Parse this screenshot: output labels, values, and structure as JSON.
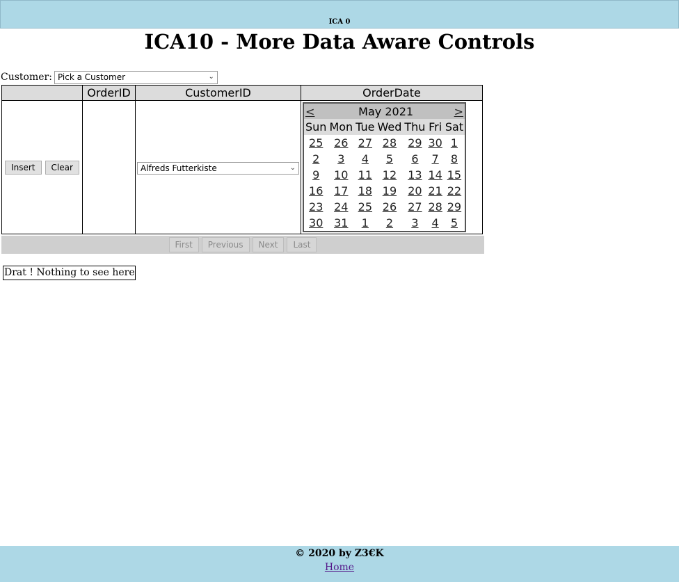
{
  "header": {
    "tag": "ICA 0",
    "title": "ICA10 - More Data Aware Controls"
  },
  "customer_filter": {
    "label": "Customer:",
    "selected": "Pick a Customer"
  },
  "grid": {
    "columns": [
      "",
      "OrderID",
      "CustomerID",
      "OrderDate"
    ],
    "row": {
      "insert_label": "Insert",
      "clear_label": "Clear",
      "order_id": "",
      "customer_selected": "Alfreds Futterkiste"
    }
  },
  "calendar": {
    "prev": "<",
    "next": ">",
    "title": "May 2021",
    "weekdays": [
      "Sun",
      "Mon",
      "Tue",
      "Wed",
      "Thu",
      "Fri",
      "Sat"
    ],
    "weeks": [
      [
        "25",
        "26",
        "27",
        "28",
        "29",
        "30",
        "1"
      ],
      [
        "2",
        "3",
        "4",
        "5",
        "6",
        "7",
        "8"
      ],
      [
        "9",
        "10",
        "11",
        "12",
        "13",
        "14",
        "15"
      ],
      [
        "16",
        "17",
        "18",
        "19",
        "20",
        "21",
        "22"
      ],
      [
        "23",
        "24",
        "25",
        "26",
        "27",
        "28",
        "29"
      ],
      [
        "30",
        "31",
        "1",
        "2",
        "3",
        "4",
        "5"
      ]
    ]
  },
  "pager": {
    "first": "First",
    "previous": "Previous",
    "next": "Next",
    "last": "Last"
  },
  "message": "Drat ! Nothing to see here",
  "footer": {
    "copyright": "© 2020 by Z3€K",
    "home_link": "Home"
  }
}
